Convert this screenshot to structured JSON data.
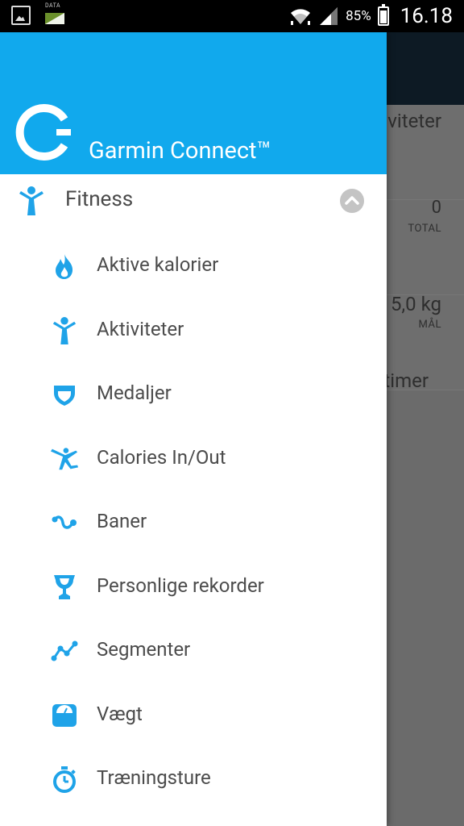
{
  "status_bar": {
    "data_label": "DATA",
    "battery_percent": "85%",
    "time": "16.18"
  },
  "background_app": {
    "row1_text": "viteter",
    "row2_value": "0",
    "row2_sub": "TOTAL",
    "row3_value": "5,0 kg",
    "row3_sub": "MÅL",
    "row4_text": "timer"
  },
  "drawer": {
    "title": "Garmin Connect™",
    "section": {
      "label": "Fitness",
      "expanded": true
    },
    "items": [
      {
        "label": "Aktive kalorier",
        "icon": "flame-icon"
      },
      {
        "label": "Aktiviteter",
        "icon": "person-icon"
      },
      {
        "label": "Medaljer",
        "icon": "shield-icon"
      },
      {
        "label": "Calories In/Out",
        "icon": "jumping-person-icon"
      },
      {
        "label": "Baner",
        "icon": "route-icon"
      },
      {
        "label": "Personlige rekorder",
        "icon": "trophy-icon"
      },
      {
        "label": "Segmenter",
        "icon": "segment-icon"
      },
      {
        "label": "Vægt",
        "icon": "scale-icon"
      },
      {
        "label": "Træningsture",
        "icon": "stopwatch-icon"
      }
    ],
    "accent_color": "#11a9ed",
    "icon_color": "#1fa3e8"
  }
}
